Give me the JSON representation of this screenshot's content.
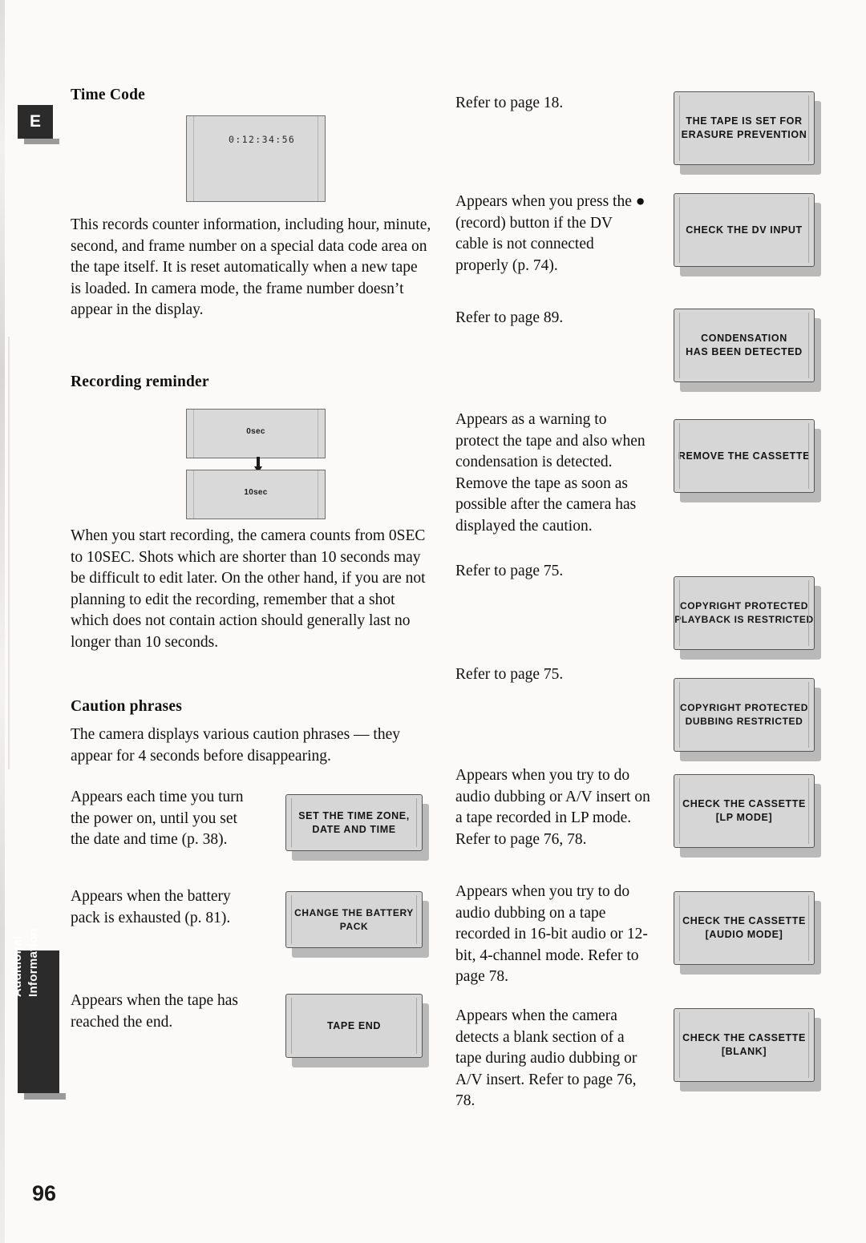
{
  "page": {
    "number": "96",
    "edge_tab_letter": "E",
    "side_tab_line1": "Additional",
    "side_tab_line2": "Information"
  },
  "left_column": {
    "time_code": {
      "heading": "Time Code",
      "lcd_value": "0:12:34:56",
      "body": "This records counter information, including hour, minute, second, and frame number on a special data code area on the tape itself. It is reset automatically when a new tape is loaded. In camera mode, the frame number doesn’t appear in the display."
    },
    "recording_reminder": {
      "heading": "Recording reminder",
      "lcd_value_top": "0sec",
      "lcd_value_bottom": "10sec",
      "body": "When you start recording, the camera counts from 0SEC to 10SEC. Shots which are shorter than 10 seconds may be difficult to edit later. On the other hand, if you are not planning to edit the recording, remember that a shot which does not contain action should generally last no longer than 10 seconds."
    },
    "caution_phrases": {
      "heading": "Caution phrases",
      "intro": "The camera displays various caution phrases — they appear for 4 seconds before disappearing.",
      "items": [
        {
          "description": "Appears each time you turn the power on, until you set the date and time (p. 38).",
          "message": "SET THE TIME ZONE,\nDATE AND TIME"
        },
        {
          "description": "Appears when the battery pack is exhausted (p. 81).",
          "message": "CHANGE THE BATTERY PACK"
        },
        {
          "description": "Appears when the tape has reached the end.",
          "message": "TAPE END"
        }
      ]
    }
  },
  "right_column": {
    "items": [
      {
        "description": "Refer to page 18.",
        "message": "THE TAPE IS SET FOR\nERASURE PREVENTION"
      },
      {
        "description": "Appears when you press the ● (record) button if the DV cable is not connected properly (p. 74).",
        "message": "CHECK THE DV INPUT"
      },
      {
        "description": "Refer to page 89.",
        "message": "CONDENSATION\nHAS BEEN DETECTED"
      },
      {
        "description": "Appears as a warning to protect the tape and also when condensation is detected. Remove the tape as soon as possible after the camera has displayed the caution.",
        "message": "REMOVE THE CASSETTE"
      },
      {
        "description": "Refer to page 75.",
        "message": "COPYRIGHT PROTECTED\nPLAYBACK IS RESTRICTED"
      },
      {
        "description": "Refer to page 75.",
        "message": "COPYRIGHT PROTECTED\nDUBBING RESTRICTED"
      },
      {
        "description": "Appears when you try to do audio dubbing or A/V insert on a tape recorded in LP mode. Refer to page 76, 78.",
        "message": "CHECK THE CASSETTE\n[LP MODE]"
      },
      {
        "description": "Appears when you try to do audio dubbing on a tape recorded in 16-bit audio or 12-bit, 4-channel mode. Refer to page 78.",
        "message": "CHECK THE CASSETTE\n[AUDIO MODE]"
      },
      {
        "description": "Appears when the camera detects a blank section of a tape during audio dubbing or A/V insert. Refer to page 76, 78.",
        "message": "CHECK THE CASSETTE\n[BLANK]"
      }
    ]
  }
}
